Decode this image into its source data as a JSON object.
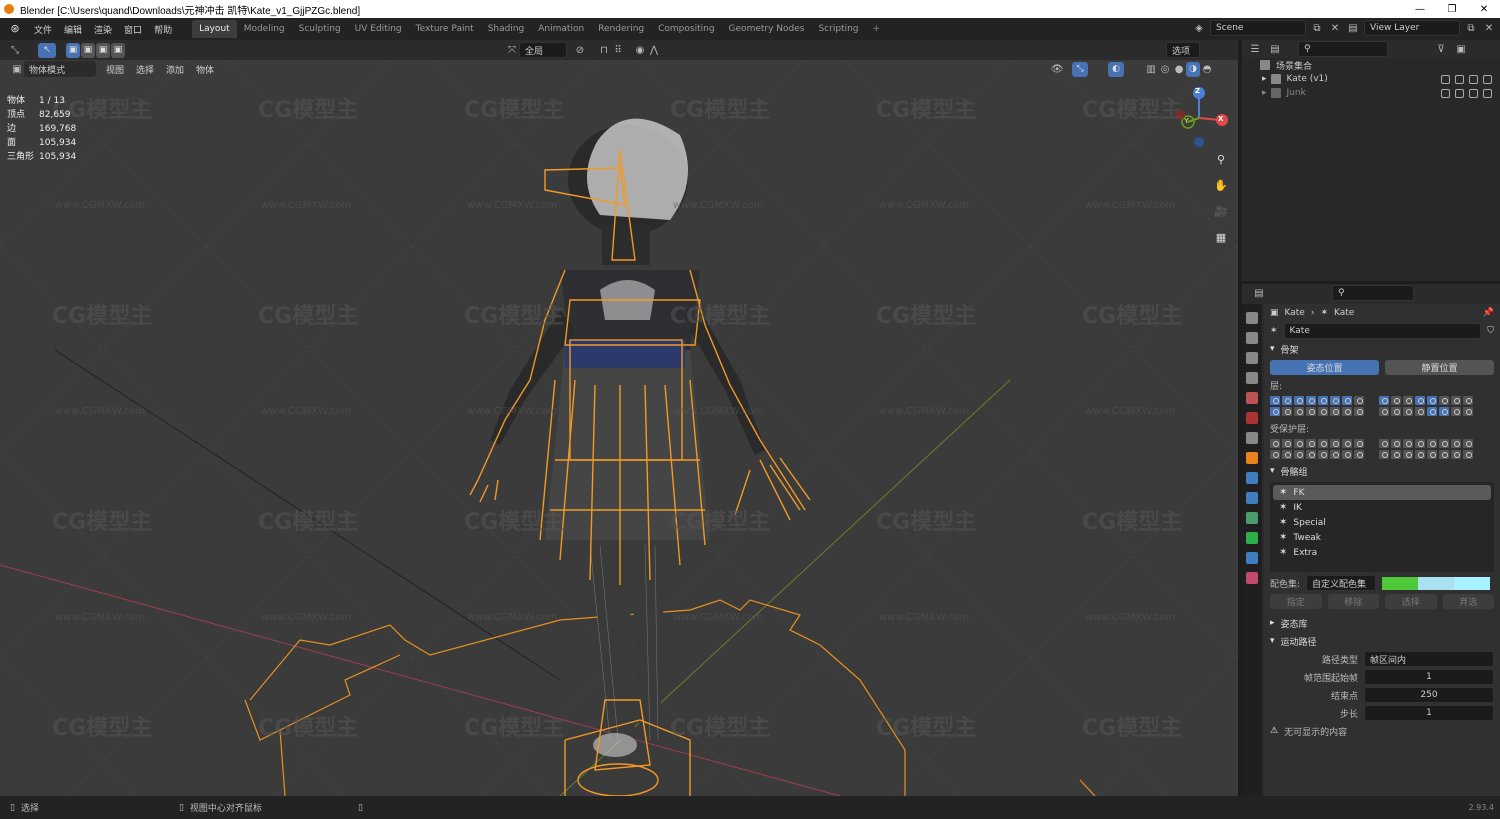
{
  "window": {
    "title": "Blender [C:\\Users\\quand\\Downloads\\元神冲击  凯特\\Kate_v1_GjjPZGc.blend]",
    "controls": [
      "—",
      "❐",
      "✕"
    ]
  },
  "menubar": {
    "items": [
      "文件",
      "编辑",
      "渲染",
      "窗口",
      "帮助"
    ],
    "workspaces": [
      "Layout",
      "Modeling",
      "Sculpting",
      "UV Editing",
      "Texture Paint",
      "Shading",
      "Animation",
      "Rendering",
      "Compositing",
      "Geometry Nodes",
      "Scripting"
    ],
    "active_workspace": "Layout",
    "add_tab": "+",
    "scene": "Scene",
    "view_layer": "View Layer"
  },
  "viewport": {
    "mode": "物体模式",
    "menu": [
      "视图",
      "选择",
      "添加",
      "物体"
    ],
    "transform_orientation": "全局",
    "options_label": "选项",
    "stats": [
      {
        "key": "物体",
        "value": "1 / 13"
      },
      {
        "key": "顶点",
        "value": "82,659"
      },
      {
        "key": "边",
        "value": "169,768"
      },
      {
        "key": "面",
        "value": "105,934"
      },
      {
        "key": "三角形",
        "value": "105,934"
      }
    ],
    "axes": {
      "x": "X",
      "y": "Y",
      "z": "Z"
    }
  },
  "outliner": {
    "root": "场景集合",
    "items": [
      {
        "name": "Kate (v1)"
      },
      {
        "name": "Junk"
      }
    ]
  },
  "properties": {
    "object_name": "Kate",
    "data_name": "Kate",
    "armature_field": "Kate",
    "skeleton_header": "骨架",
    "pose_position": "姿态位置",
    "rest_position": "静置位置",
    "layers_label": "层:",
    "protected_layers_label": "受保护层:",
    "bone_groups_header": "骨骼组",
    "bone_groups": [
      "FK",
      "IK",
      "Special",
      "Tweak",
      "Extra"
    ],
    "color_set_label": "配色集:",
    "color_set_value": "自定义配色集",
    "color_set_swatches": [
      "#4fc93a",
      "#a9e1f0",
      "#a8f2ff"
    ],
    "group_buttons": [
      "指定",
      "移除",
      "选择",
      "弃选"
    ],
    "pose_library": "姿态库",
    "motion_paths": "运动路径",
    "path_type_label": "路径类型",
    "path_type_value": "帧区间内",
    "frame_range_start_label": "帧范围起始帧",
    "frame_range_start": "1",
    "frame_end_label": "结束点",
    "frame_end": "250",
    "step_label": "步长",
    "step": "1",
    "nothing_label": "无可显示的内容"
  },
  "statusbar": {
    "select": "选择",
    "center_view": "视图中心对齐鼠标",
    "version": "2.93.4"
  },
  "watermark": {
    "text": "CG模型主",
    "url": "www.CGMXW.com"
  }
}
